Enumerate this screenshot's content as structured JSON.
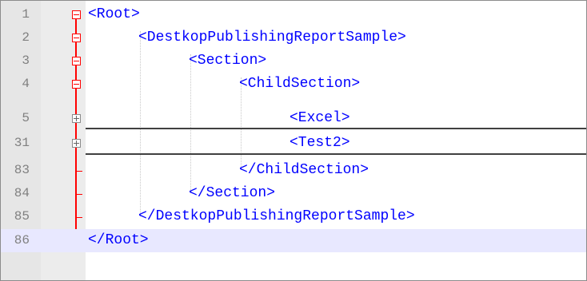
{
  "editor": {
    "lines": [
      {
        "number": "1",
        "tag": "<Root>"
      },
      {
        "number": "2",
        "tag": "<DestkopPublishingReportSample>"
      },
      {
        "number": "3",
        "tag": "<Section>"
      },
      {
        "number": "4",
        "tag": "<ChildSection>"
      },
      {
        "number": "5",
        "tag": "<Excel>"
      },
      {
        "number": "31",
        "tag": "<Test2>"
      },
      {
        "number": "83",
        "tag": "</ChildSection>"
      },
      {
        "number": "84",
        "tag": "</Section>"
      },
      {
        "number": "85",
        "tag": "</DestkopPublishingReportSample>"
      },
      {
        "number": "86",
        "tag": "</Root>"
      }
    ],
    "colors": {
      "tag": "#0000ff",
      "fold_marker": "#ff0000",
      "current_line": "#e8e8ff",
      "gutter": "#e6e6e6",
      "line_number": "#808080"
    },
    "icons": {
      "collapse": "fold-collapse-icon",
      "expand": "fold-expand-icon"
    },
    "current_line": "86"
  }
}
